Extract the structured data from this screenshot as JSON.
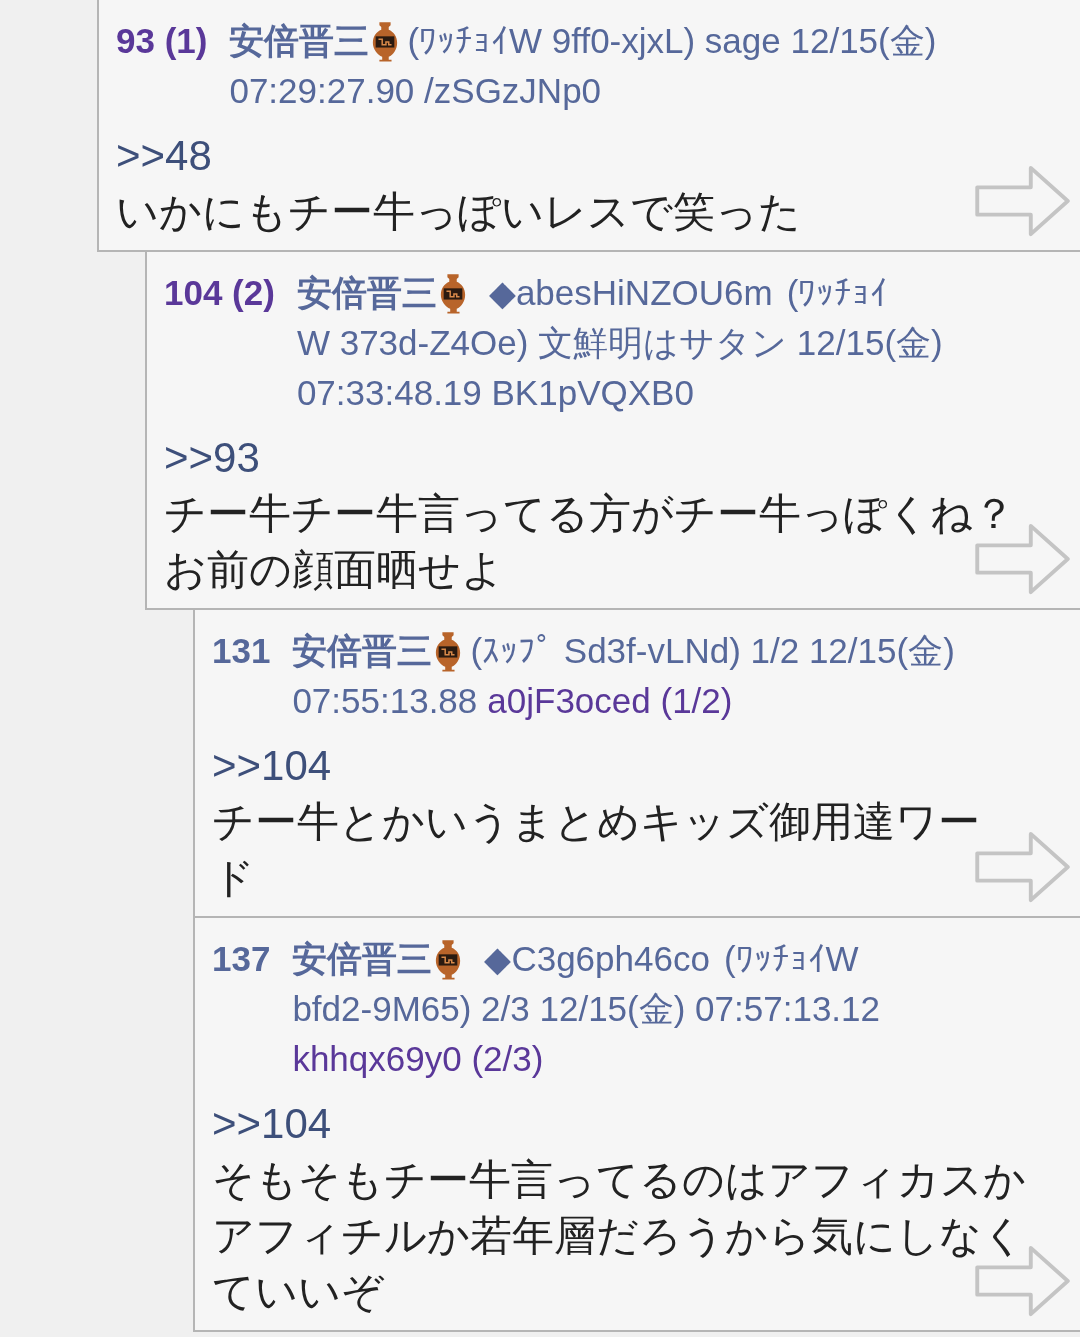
{
  "posts": [
    {
      "number": "93",
      "reply_count": "(1)",
      "highlighted": true,
      "header_lines": [
        [
          {
            "kind": "name",
            "text": "安倍晋三"
          },
          {
            "kind": "text",
            "text": "(ﾜｯﾁｮｲW 9ff0-xjxL) sage 12/15(金)"
          }
        ],
        [
          {
            "kind": "text",
            "text": "07:29:27.90 /zSGzJNp0"
          }
        ]
      ],
      "anchor": ">>48",
      "body": [
        "いかにもチー牛っぽいレスで笑った"
      ],
      "children": [
        {
          "number": "104",
          "reply_count": "(2)",
          "highlighted": true,
          "header_lines": [
            [
              {
                "kind": "name",
                "text": "安倍晋三"
              },
              {
                "kind": "trip",
                "text": "◆abesHiNZOU6m"
              },
              {
                "kind": "text",
                "text": "(ﾜｯﾁｮｲ"
              }
            ],
            [
              {
                "kind": "text",
                "text": "W 373d-Z4Oe) 文鮮明はサタン 12/15(金)"
              }
            ],
            [
              {
                "kind": "text",
                "text": "07:33:48.19 BK1pVQXB0"
              }
            ]
          ],
          "anchor": ">>93",
          "body": [
            "チー牛チー牛言ってる方がチー牛っぽくね？",
            "お前の顔面晒せよ"
          ],
          "children": [
            {
              "number": "131",
              "highlighted": false,
              "header_lines": [
                [
                  {
                    "kind": "name",
                    "text": "安倍晋三"
                  },
                  {
                    "kind": "text",
                    "text": "(ｽｯﾌﾟ Sd3f-vLNd) 1/2  12/15(金)"
                  }
                ],
                [
                  {
                    "kind": "text",
                    "text": "07:55:13.88"
                  },
                  {
                    "kind": "link",
                    "text": "a0jF3oced (1/2)"
                  }
                ]
              ],
              "anchor": ">>104",
              "body": [
                "チー牛とかいうまとめキッズ御用達ワー",
                "ド"
              ]
            },
            {
              "number": "137",
              "highlighted": false,
              "header_lines": [
                [
                  {
                    "kind": "name",
                    "text": "安倍晋三"
                  },
                  {
                    "kind": "trip",
                    "text": "◆C3g6ph46co"
                  },
                  {
                    "kind": "text",
                    "text": "(ﾜｯﾁｮｲW"
                  }
                ],
                [
                  {
                    "kind": "text",
                    "text": "bfd2-9M65) 2/3  12/15(金) 07:57:13.12"
                  }
                ],
                [
                  {
                    "kind": "link",
                    "text": "khhqx69y0 (2/3)"
                  }
                ]
              ],
              "anchor": ">>104",
              "body": [
                "そもそもチー牛言ってるのはアフィカスか",
                "アフィチルか若年層だろうから気にしなく",
                "ていいぞ"
              ]
            }
          ]
        }
      ]
    }
  ]
}
